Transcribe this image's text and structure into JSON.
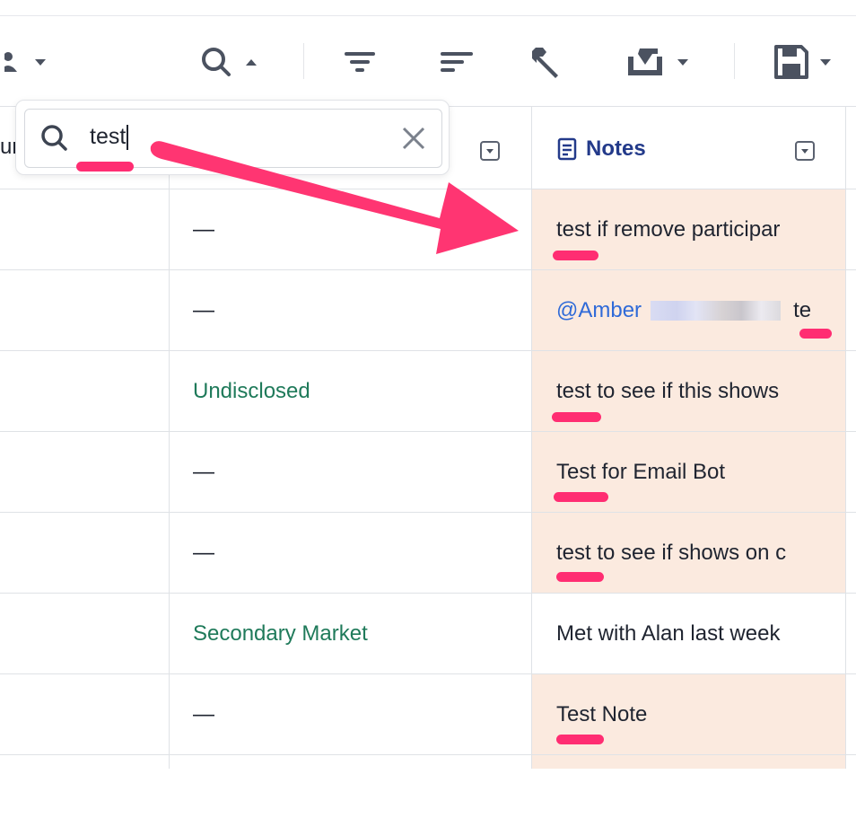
{
  "colors": {
    "accent": "#233a8a",
    "highlight": "#fbeadf",
    "annotation": "#ff2d72",
    "green_text": "#1f7a5a",
    "mention": "#2f6ad8"
  },
  "toolbar": {
    "icons": [
      "people-icon",
      "search-icon",
      "filter-icon",
      "sort-icon",
      "wrench-icon",
      "export-icon",
      "save-icon"
    ]
  },
  "search": {
    "value": "test",
    "clear_icon": "close-icon"
  },
  "header": {
    "left_partial": "ur",
    "notes_title": "Notes"
  },
  "rows": [
    {
      "mid": "—",
      "notes": "test if remove participar",
      "highlight": true
    },
    {
      "mid": "—",
      "notes_mention": "@Amber",
      "notes_tail": "te",
      "highlight": true
    },
    {
      "mid": "Undisclosed",
      "notes": "test to see if this shows",
      "highlight": true
    },
    {
      "mid": "—",
      "notes": "Test for Email Bot",
      "highlight": true
    },
    {
      "mid": "—",
      "notes": "test to see if shows on c",
      "highlight": true
    },
    {
      "mid": "Secondary Market",
      "notes": "Met with Alan last week",
      "highlight": false
    },
    {
      "mid": "—",
      "notes": "Test Note",
      "highlight": true
    }
  ]
}
